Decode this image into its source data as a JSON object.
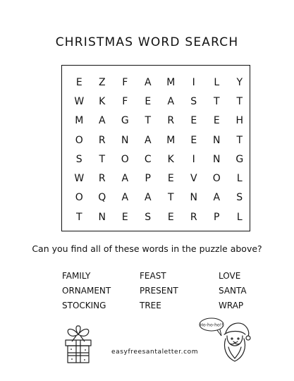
{
  "title": "CHRISTMAS WORD SEARCH",
  "grid": [
    [
      "E",
      "Z",
      "F",
      "A",
      "M",
      "I",
      "L",
      "Y"
    ],
    [
      "W",
      "K",
      "F",
      "E",
      "A",
      "S",
      "T",
      "T"
    ],
    [
      "M",
      "A",
      "G",
      "T",
      "R",
      "E",
      "E",
      "H"
    ],
    [
      "O",
      "R",
      "N",
      "A",
      "M",
      "E",
      "N",
      "T"
    ],
    [
      "S",
      "T",
      "O",
      "C",
      "K",
      "I",
      "N",
      "G"
    ],
    [
      "W",
      "R",
      "A",
      "P",
      "E",
      "V",
      "O",
      "L"
    ],
    [
      "O",
      "Q",
      "A",
      "A",
      "T",
      "N",
      "A",
      "S"
    ],
    [
      "T",
      "N",
      "E",
      "S",
      "E",
      "R",
      "P",
      "L"
    ]
  ],
  "prompt": "Can you find all of these words in the puzzle above?",
  "words": [
    "FAMILY",
    "FEAST",
    "LOVE",
    "ORNAMENT",
    "PRESENT",
    "SANTA",
    "STOCKING",
    "TREE",
    "WRAP"
  ],
  "website": "easyfreesantaletter.com",
  "santa_bubble": "Ho-ho-ho!!"
}
